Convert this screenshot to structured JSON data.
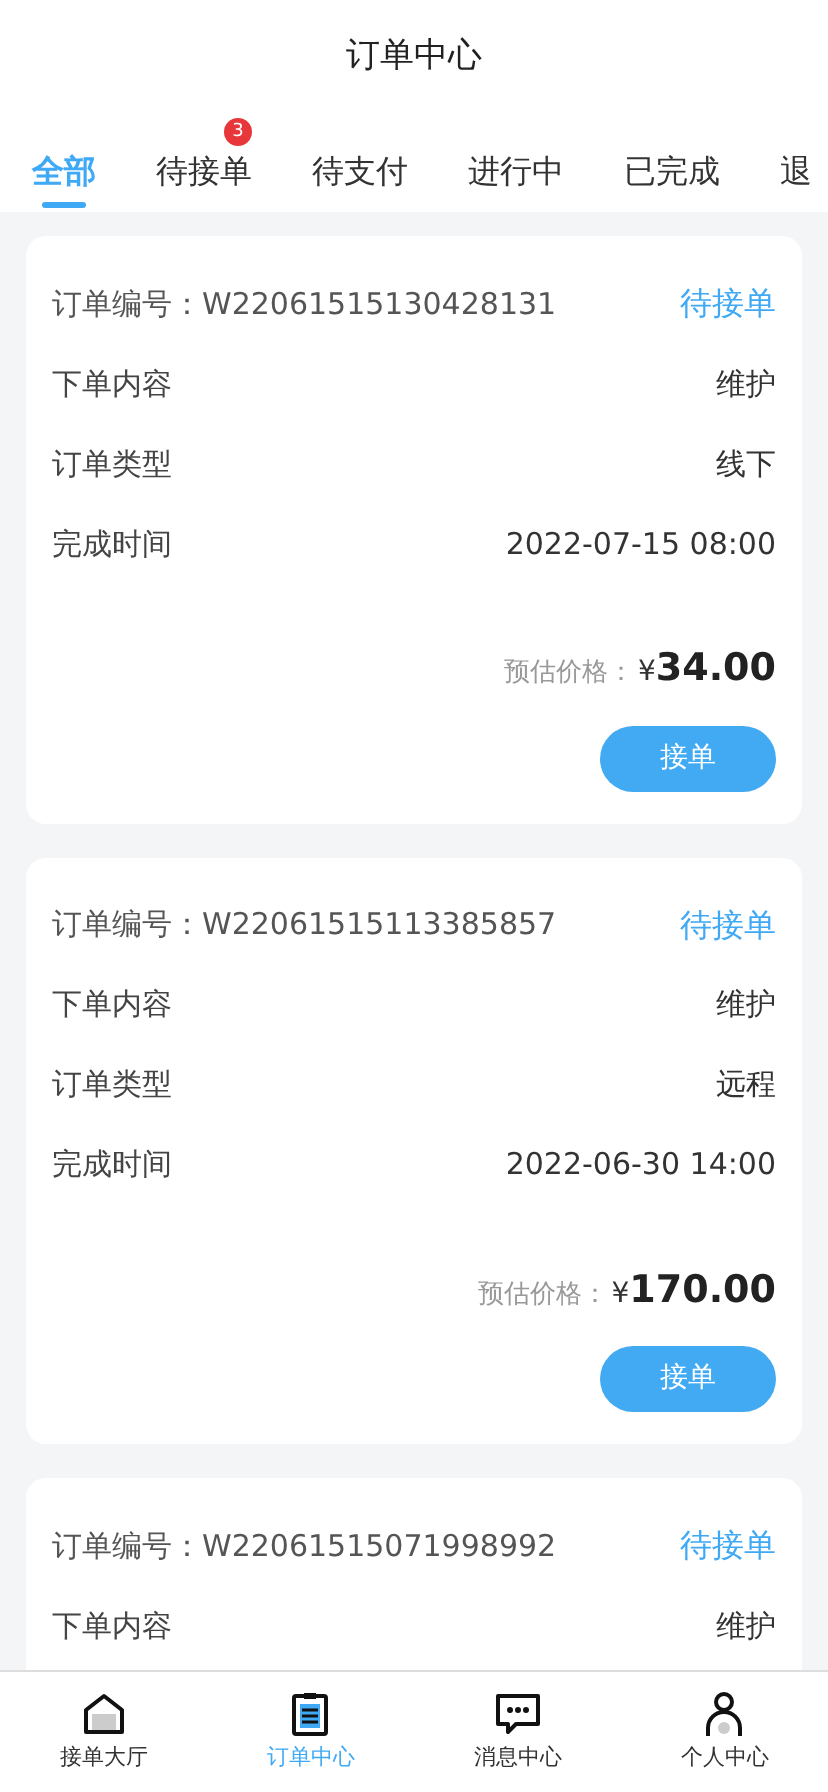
{
  "header": {
    "title": "订单中心"
  },
  "tabs": [
    {
      "label": "全部",
      "selected": true
    },
    {
      "label": "待接单",
      "selected": false,
      "badge": "3"
    },
    {
      "label": "待支付",
      "selected": false
    },
    {
      "label": "进行中",
      "selected": false
    },
    {
      "label": "已完成",
      "selected": false
    },
    {
      "label": "退",
      "selected": false
    }
  ],
  "orders": [
    {
      "number_label": "订单编号：",
      "number": "W22061515130428131",
      "status": "待接单",
      "fields": [
        {
          "label": "下单内容",
          "value": "维护"
        },
        {
          "label": "订单类型",
          "value": "线下"
        },
        {
          "label": "完成时间",
          "value": "2022-07-15 08:00"
        }
      ],
      "price_label": "预估价格：",
      "currency": "¥",
      "price": "34.00",
      "button": "接单"
    },
    {
      "number_label": "订单编号：",
      "number": "W22061515113385857",
      "status": "待接单",
      "fields": [
        {
          "label": "下单内容",
          "value": "维护"
        },
        {
          "label": "订单类型",
          "value": "远程"
        },
        {
          "label": "完成时间",
          "value": "2022-06-30 14:00"
        }
      ],
      "price_label": "预估价格：",
      "currency": "¥",
      "price": "170.00",
      "button": "接单"
    },
    {
      "number_label": "订单编号：",
      "number": "W22061515071998992",
      "status": "待接单",
      "fields": [
        {
          "label": "下单内容",
          "value": "维护"
        }
      ]
    }
  ],
  "bottom_nav": [
    {
      "label": "接单大厅",
      "kind": "home",
      "selected": false
    },
    {
      "label": "订单中心",
      "kind": "orders",
      "selected": true
    },
    {
      "label": "消息中心",
      "kind": "message",
      "selected": false
    },
    {
      "label": "个人中心",
      "kind": "person",
      "selected": false
    }
  ]
}
